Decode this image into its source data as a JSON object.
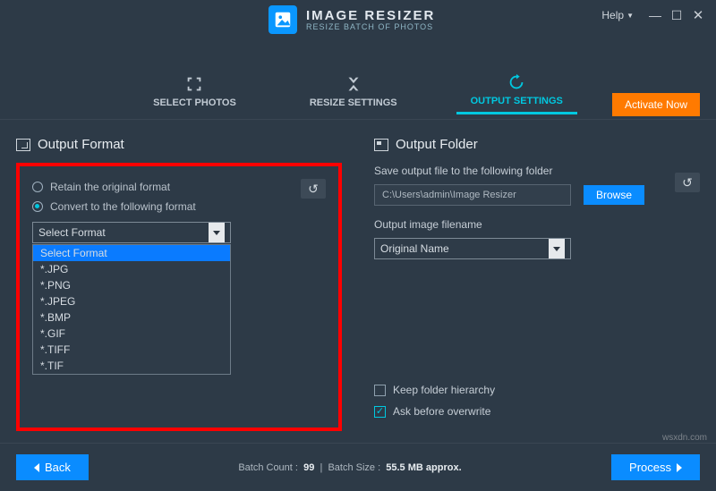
{
  "app": {
    "title": "IMAGE RESIZER",
    "subtitle": "RESIZE BATCH OF PHOTOS",
    "help_label": "Help"
  },
  "tabs": {
    "select_photos": "SELECT PHOTOS",
    "resize_settings": "RESIZE SETTINGS",
    "output_settings": "OUTPUT SETTINGS"
  },
  "activate": "Activate Now",
  "output_format": {
    "title": "Output Format",
    "retain": "Retain the original format",
    "convert": "Convert to the following format",
    "select_placeholder": "Select Format",
    "options": [
      "Select Format",
      "*.JPG",
      "*.PNG",
      "*.JPEG",
      "*.BMP",
      "*.GIF",
      "*.TIFF",
      "*.TIF"
    ]
  },
  "output_folder": {
    "title": "Output Folder",
    "save_label": "Save output file to the following folder",
    "path": "C:\\Users\\admin\\Image Resizer",
    "browse": "Browse",
    "filename_label": "Output image filename",
    "filename_value": "Original Name",
    "keep_hierarchy": "Keep folder hierarchy",
    "ask_overwrite": "Ask before overwrite"
  },
  "footer": {
    "back": "Back",
    "process": "Process",
    "batch_count_label": "Batch Count :",
    "batch_count": "99",
    "batch_size_label": "Batch Size :",
    "batch_size": "55.5 MB approx."
  },
  "watermark": "wsxdn.com"
}
